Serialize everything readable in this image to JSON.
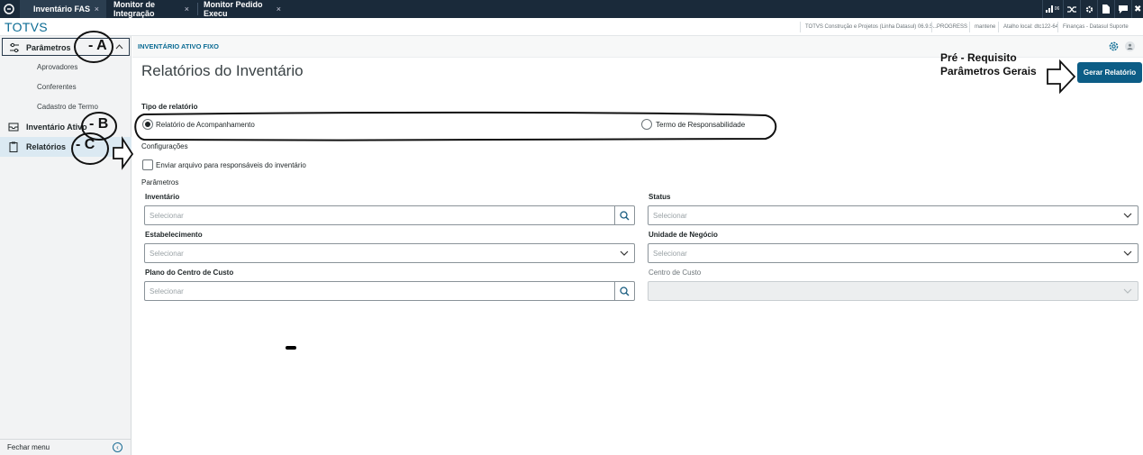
{
  "tabs": [
    {
      "label": "Inventário FAS",
      "close": "×"
    },
    {
      "label": "Monitor de Integração",
      "close": "×"
    },
    {
      "label": "Monitor Pedido Execu",
      "close": "×"
    }
  ],
  "topbar_icons": {
    "signal_badge": "06"
  },
  "brand": "TOTVS",
  "info_bar": [
    "TOTVS Construção e Projetos (Linha Datasul) 06.9.5...",
    "PROGRESS",
    "mantene",
    "Atalho local: dtc122-64",
    "Finanças - Datasul Suporte"
  ],
  "sidebar": {
    "parametros": "Parâmetros",
    "sub_items": [
      "Aprovadores",
      "Conferentes",
      "Cadastro de Termo"
    ],
    "inventario": "Inventário Ativo",
    "relatorios": "Relatórios",
    "footer": "Fechar menu"
  },
  "breadcrumb": "INVENTÁRIO ATIVO FIXO",
  "page_title": "Relatórios do Inventário",
  "prereq_note": "Pré - Requisito\nParâmetros Gerais",
  "gerar_button": "Gerar Relatório",
  "tipo_label": "Tipo de relatório",
  "radios": [
    {
      "label": "Relatório de Acompanhamento",
      "selected": true
    },
    {
      "label": "Termo de Responsabilidade",
      "selected": false
    }
  ],
  "config_label": "Configurações",
  "checkbox_label": "Enviar arquivo para responsáveis do inventário",
  "checkbox_checked": false,
  "params_label": "Parâmetros",
  "fields": {
    "inventario": {
      "label": "Inventário",
      "placeholder": "Selecionar"
    },
    "status": {
      "label": "Status",
      "placeholder": "Selecionar"
    },
    "estabelecimento": {
      "label": "Estabelecimento",
      "placeholder": "Selecionar"
    },
    "unidade": {
      "label": "Unidade de Negócio",
      "placeholder": "Selecionar"
    },
    "plano": {
      "label": "Plano do Centro de Custo",
      "placeholder": "Selecionar"
    },
    "centro": {
      "label": "Centro de Custo",
      "placeholder": ""
    }
  },
  "annotations": {
    "a": "- A",
    "b": "- B",
    "c": "- C"
  },
  "colors": {
    "primary": "#0c5d86",
    "topbar": "#1a2a3a",
    "brand": "#0c6c94"
  }
}
